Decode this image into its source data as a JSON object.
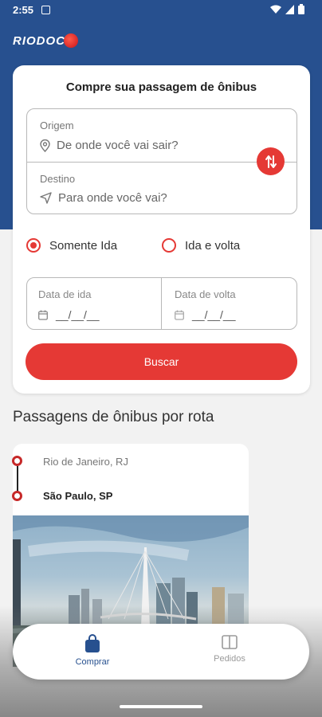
{
  "status_bar": {
    "time": "2:55"
  },
  "brand": {
    "logo_text": "RIODOC",
    "primary": "#27508f",
    "accent": "#e53935"
  },
  "search_card": {
    "title": "Compre sua passagem de ônibus",
    "origin": {
      "label": "Origem",
      "placeholder": "De onde você vai sair?"
    },
    "destination": {
      "label": "Destino",
      "placeholder": "Para onde você vai?"
    },
    "trip_type": {
      "one_way": "Somente Ida",
      "round_trip": "Ida e volta",
      "selected": "one_way"
    },
    "depart_date": {
      "label": "Data de ida",
      "value": "__/__/__"
    },
    "return_date": {
      "label": "Data de volta",
      "value": "__/__/__"
    },
    "search_button": "Buscar"
  },
  "routes_section": {
    "title": "Passagens de ônibus por rota",
    "routes": [
      {
        "from": "Rio de Janeiro, RJ",
        "to": "São Paulo, SP"
      }
    ]
  },
  "bottom_nav": {
    "items": [
      {
        "label": "Comprar",
        "icon": "shopping-bag-icon",
        "active": true
      },
      {
        "label": "Pedidos",
        "icon": "ticket-icon",
        "active": false
      }
    ]
  }
}
